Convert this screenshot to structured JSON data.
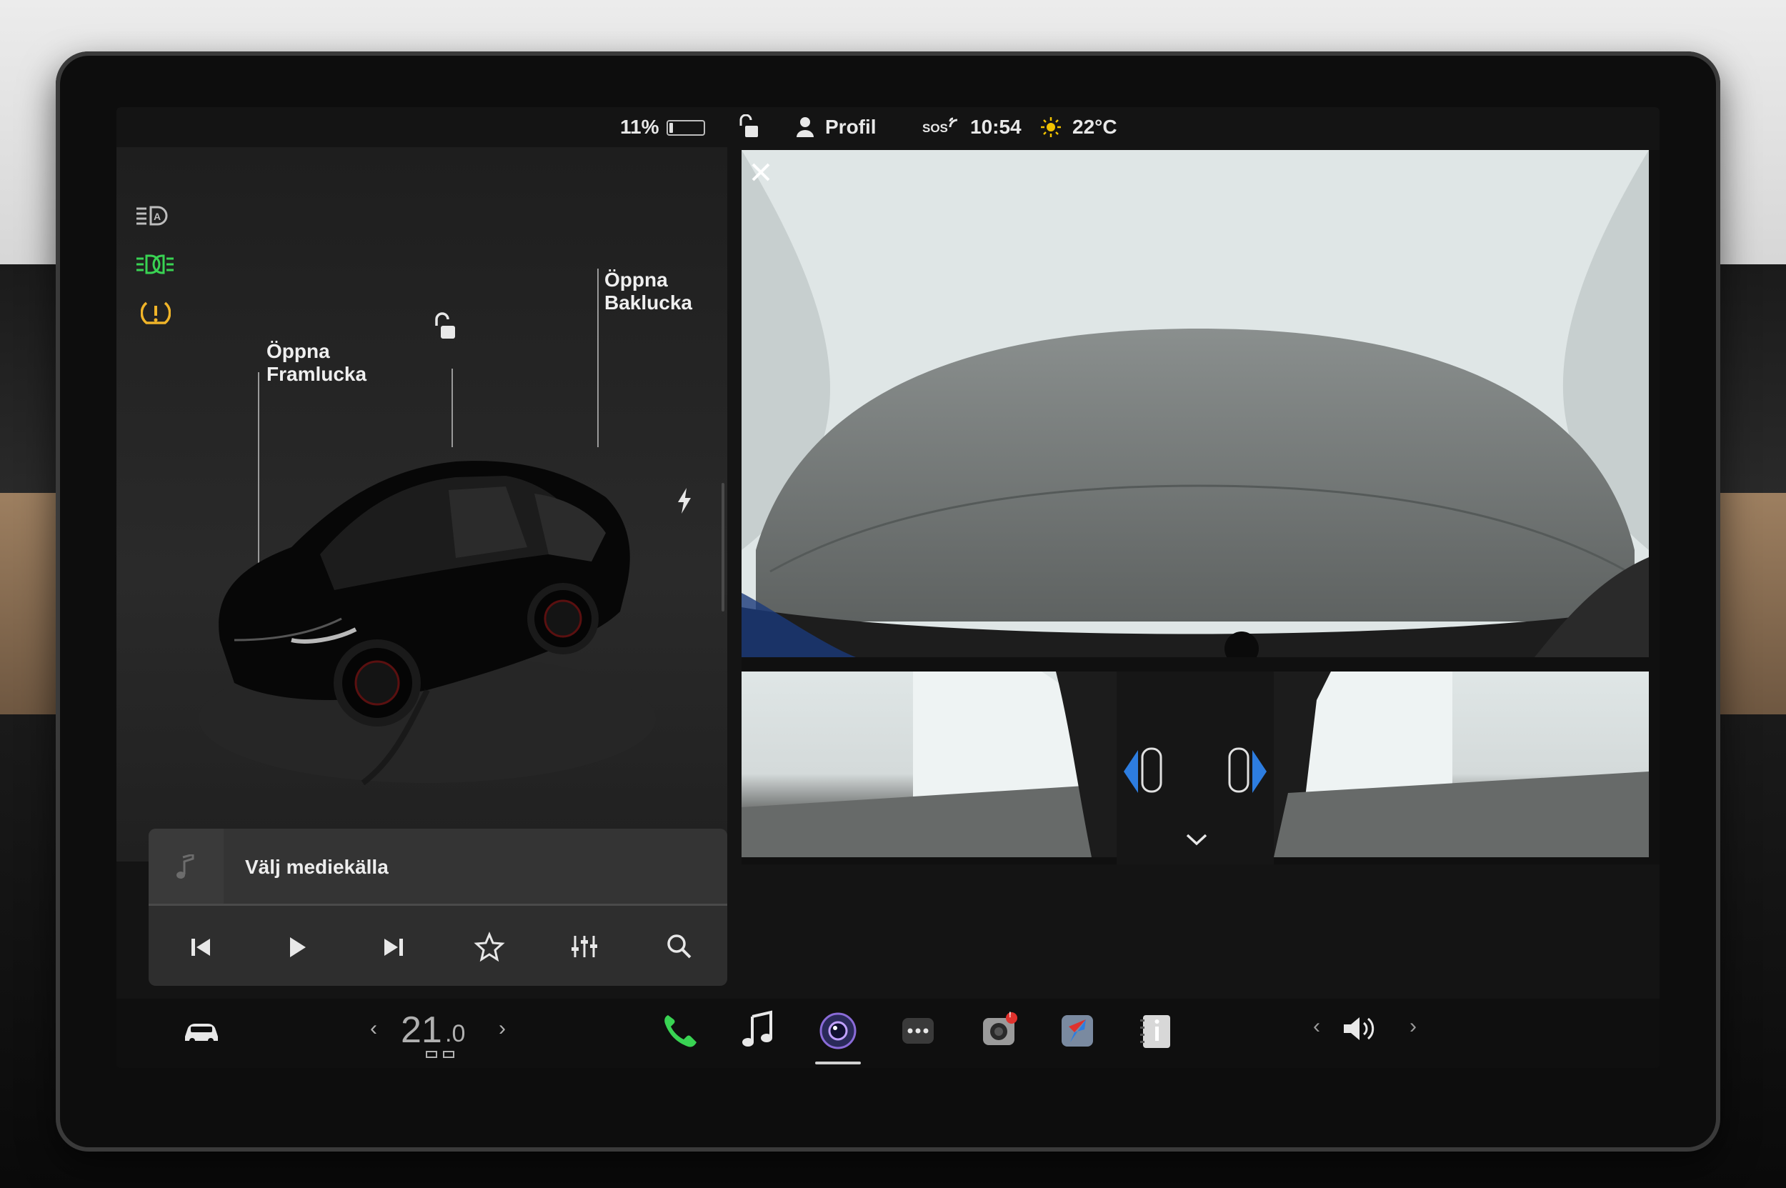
{
  "status_bar": {
    "battery_percent": "11%",
    "battery_level": 0.11,
    "profile_label": "Profil",
    "sos_label": "SOS",
    "time": "10:54",
    "temperature": "22°C"
  },
  "indicators": [
    "auto-headlight-icon",
    "parking-lights-icon",
    "tire-pressure-warning-icon"
  ],
  "car": {
    "front_trunk_label_line1": "Öppna",
    "front_trunk_label_line2": "Framlucka",
    "rear_trunk_label_line1": "Öppna",
    "rear_trunk_label_line2": "Baklucka"
  },
  "media": {
    "source_label": "Välj mediekälla",
    "controls": [
      "previous-icon",
      "play-icon",
      "next-icon",
      "favorite-icon",
      "equalizer-icon",
      "search-icon"
    ]
  },
  "climate": {
    "temperature_whole": "21",
    "temperature_decimal": ".0"
  },
  "dock": {
    "apps": [
      "phone-icon",
      "music-icon",
      "camera-icon",
      "more-icon",
      "dashcam-icon",
      "navigation-icon",
      "manual-icon"
    ],
    "notification_count": "!"
  },
  "colors": {
    "accent_green": "#39d353",
    "warning_yellow": "#f0b429",
    "sensor_blue": "#2d7de0"
  }
}
